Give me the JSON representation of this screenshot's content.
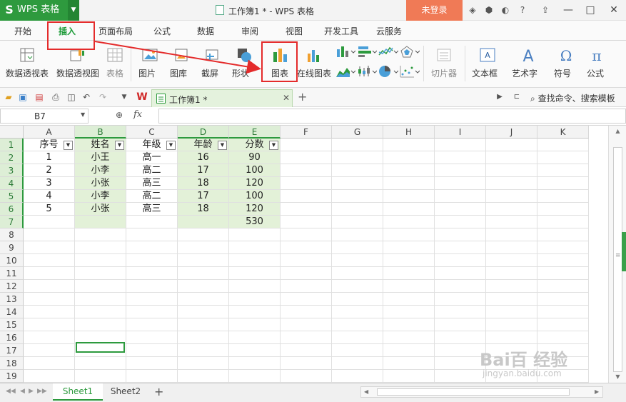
{
  "app": {
    "logo": "S",
    "name": "WPS 表格",
    "window_title": "工作簿1 * - WPS 表格",
    "login_label": "未登录"
  },
  "window_controls": [
    "—",
    "□",
    "✕"
  ],
  "menu_tabs": [
    "开始",
    "插入",
    "页面布局",
    "公式",
    "数据",
    "审阅",
    "视图",
    "开发工具",
    "云服务"
  ],
  "active_menu_tab": "插入",
  "ribbon": {
    "pivot_table": "数据透视表",
    "pivot_chart": "数据透视图",
    "table": "表格",
    "picture": "图片",
    "gallery": "图库",
    "screenshot": "截屏",
    "shape": "形状",
    "chart": "图表",
    "online_chart": "在线图表",
    "slicer": "切片器",
    "textbox": "文本框",
    "wordart": "艺术字",
    "symbol": "符号",
    "formula": "公式"
  },
  "doc_tab": {
    "label": "工作簿1 *"
  },
  "search_command": "查找命令、搜索模板",
  "formula_bar": {
    "name_box": "B7",
    "fx": "fx",
    "value": ""
  },
  "columns": [
    "A",
    "B",
    "C",
    "D",
    "E",
    "F",
    "G",
    "H",
    "I",
    "J",
    "K"
  ],
  "selected_columns": [
    "B",
    "D",
    "E"
  ],
  "rows": [
    "1",
    "2",
    "3",
    "4",
    "5",
    "6",
    "7",
    "8",
    "9",
    "10",
    "11",
    "12",
    "13",
    "14",
    "15",
    "16",
    "17",
    "18",
    "19"
  ],
  "selected_rows": [
    "1",
    "2",
    "3",
    "4",
    "5",
    "6",
    "7"
  ],
  "table": {
    "headers": [
      "序号",
      "姓名",
      "年级",
      "年龄",
      "分数"
    ],
    "rows": [
      [
        "1",
        "小王",
        "高一",
        "16",
        "90"
      ],
      [
        "2",
        "小李",
        "高二",
        "17",
        "100"
      ],
      [
        "3",
        "小张",
        "高三",
        "18",
        "120"
      ],
      [
        "4",
        "小李",
        "高二",
        "17",
        "100"
      ],
      [
        "5",
        "小张",
        "高三",
        "18",
        "120"
      ]
    ],
    "total_row": [
      "",
      "",
      "",
      "",
      "530"
    ]
  },
  "sheets": [
    "Sheet1",
    "Sheet2"
  ],
  "active_sheet": "Sheet1",
  "watermark": {
    "main": "Bai百 经验",
    "sub": "jingyan.baidu.com"
  },
  "colors": {
    "brand_green": "#2e9a3e",
    "login_orange": "#f07a56",
    "highlight_red": "#e42b2b",
    "selection_fill": "#e3f1d8"
  }
}
